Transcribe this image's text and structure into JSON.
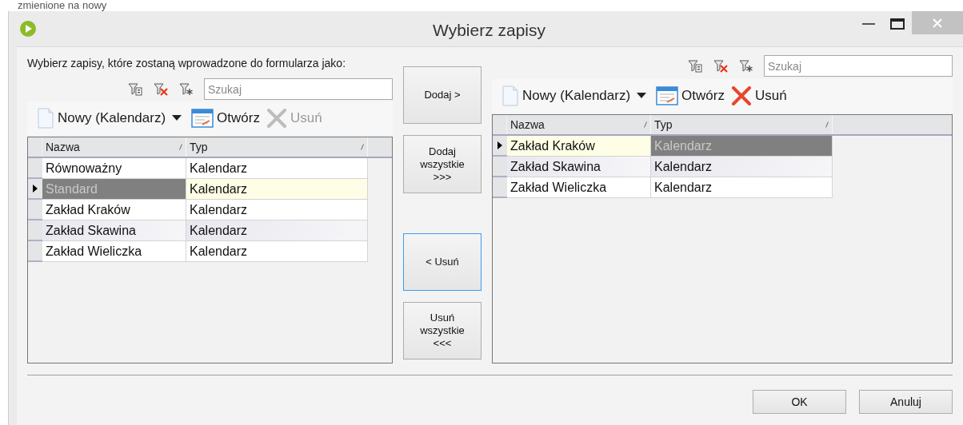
{
  "background_text": "zmienione na nowy",
  "window": {
    "title": "Wybierz zapisy"
  },
  "instruction": "Wybierz zapisy, które zostaną wprowadzone do formularza jako:",
  "left": {
    "search": {
      "placeholder": "Szukaj"
    },
    "toolbar": [
      {
        "kind": "new",
        "label": "Nowy (Kalendarz)",
        "disabled": false
      },
      {
        "kind": "open",
        "label": "Otwórz",
        "disabled": false
      },
      {
        "kind": "delete",
        "label": "Usuń",
        "disabled": true
      }
    ],
    "columns": [
      "Nazwa",
      "Typ"
    ],
    "rows": [
      {
        "current": false,
        "cells": [
          {
            "text": "Równoważny",
            "selected": false
          },
          {
            "text": "Kalendarz",
            "selected": false
          }
        ]
      },
      {
        "current": true,
        "cells": [
          {
            "text": "Standard",
            "selected": true
          },
          {
            "text": "Kalendarz",
            "selected": false
          }
        ]
      },
      {
        "current": false,
        "cells": [
          {
            "text": "Zakład Kraków",
            "selected": false
          },
          {
            "text": "Kalendarz",
            "selected": false
          }
        ]
      },
      {
        "current": false,
        "cells": [
          {
            "text": "Zakład Skawina",
            "selected": false
          },
          {
            "text": "Kalendarz",
            "selected": false
          }
        ]
      },
      {
        "current": false,
        "cells": [
          {
            "text": "Zakład Wieliczka",
            "selected": false
          },
          {
            "text": "Kalendarz",
            "selected": false
          }
        ]
      }
    ]
  },
  "transfer_buttons": [
    {
      "lines": [
        "Dodaj >"
      ],
      "focused": false
    },
    {
      "lines": [
        "Dodaj",
        "wszystkie",
        ">>>"
      ],
      "focused": false
    },
    {
      "lines": [
        "< Usuń"
      ],
      "focused": true
    },
    {
      "lines": [
        "Usuń",
        "wszystkie",
        "<<<"
      ],
      "focused": false
    }
  ],
  "right": {
    "search": {
      "placeholder": "Szukaj"
    },
    "toolbar": [
      {
        "kind": "new",
        "label": "Nowy (Kalendarz)",
        "disabled": false
      },
      {
        "kind": "open",
        "label": "Otwórz",
        "disabled": false
      },
      {
        "kind": "delete",
        "label": "Usuń",
        "disabled": false
      }
    ],
    "columns": [
      "Nazwa",
      "Typ"
    ],
    "rows": [
      {
        "current": true,
        "cells": [
          {
            "text": "Zakład Kraków",
            "selected": false
          },
          {
            "text": "Kalendarz",
            "selected": true
          }
        ]
      },
      {
        "current": false,
        "cells": [
          {
            "text": "Zakład Skawina",
            "selected": false
          },
          {
            "text": "Kalendarz",
            "selected": false
          }
        ]
      },
      {
        "current": false,
        "cells": [
          {
            "text": "Zakład Wieliczka",
            "selected": false
          },
          {
            "text": "Kalendarz",
            "selected": false
          }
        ]
      }
    ]
  },
  "buttons": [
    "OK",
    "Anuluj"
  ]
}
